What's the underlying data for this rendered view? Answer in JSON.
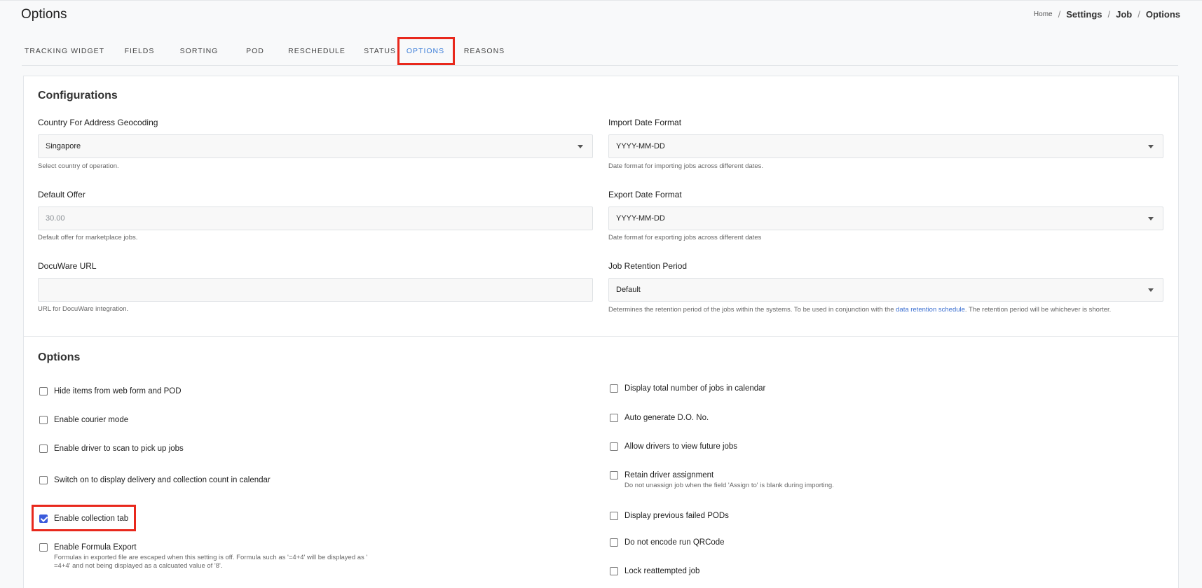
{
  "header": {
    "title": "Options",
    "breadcrumb": {
      "home": "Home",
      "settings": "Settings",
      "job": "Job",
      "current": "Options",
      "separator": "/"
    }
  },
  "tabs": [
    {
      "label": "TRACKING WIDGET",
      "active": false
    },
    {
      "label": "FIELDS",
      "active": false
    },
    {
      "label": "SORTING",
      "active": false
    },
    {
      "label": "POD",
      "active": false
    },
    {
      "label": "RESCHEDULE",
      "active": false
    },
    {
      "label": "STATUS",
      "active": false
    },
    {
      "label": "OPTIONS",
      "active": true
    },
    {
      "label": "REASONS",
      "active": false
    }
  ],
  "configurations": {
    "title": "Configurations",
    "country": {
      "label": "Country For Address Geocoding",
      "value": "Singapore",
      "help": "Select country of operation."
    },
    "import_date": {
      "label": "Import Date Format",
      "value": "YYYY-MM-DD",
      "help": "Date format for importing jobs across different dates."
    },
    "default_offer": {
      "label": "Default Offer",
      "placeholder": "30.00",
      "help": "Default offer for marketplace jobs."
    },
    "export_date": {
      "label": "Export Date Format",
      "value": "YYYY-MM-DD",
      "help": "Date format for exporting jobs across different dates"
    },
    "docuware": {
      "label": "DocuWare URL",
      "value": "",
      "help": "URL for DocuWare integration."
    },
    "retention": {
      "label": "Job Retention Period",
      "value": "Default",
      "help_before": "Determines the retention period of the jobs within the systems. To be used in conjunction with the ",
      "help_link": "data retention schedule",
      "help_after": ". The retention period will be whichever is shorter."
    }
  },
  "options": {
    "title": "Options",
    "left": [
      {
        "label": "Hide items from web form and POD",
        "checked": false
      },
      {
        "label": "Enable courier mode",
        "checked": false
      },
      {
        "label": "Enable driver to scan to pick up jobs",
        "checked": false
      },
      {
        "label": "Switch on to display delivery and collection count in calendar",
        "checked": false
      },
      {
        "label": "Enable collection tab",
        "checked": true
      },
      {
        "label": "Enable Formula Export",
        "checked": false,
        "desc": "Formulas in exported file are escaped when this setting is off. Formula such as '=4+4' will be displayed as ' =4+4' and not being displayed as a calcuated value of '8'."
      }
    ],
    "right": [
      {
        "label": "Display total number of jobs in calendar",
        "checked": false
      },
      {
        "label": "Auto generate D.O. No.",
        "checked": false
      },
      {
        "label": "Allow drivers to view future jobs",
        "checked": false
      },
      {
        "label": "Retain driver assignment",
        "checked": false,
        "desc": "Do not unassign job when the field 'Assign to' is blank during importing."
      },
      {
        "label": "Display previous failed PODs",
        "checked": false
      },
      {
        "label": "Do not encode run QRCode",
        "checked": false
      },
      {
        "label": "Lock reattempted job",
        "checked": false
      }
    ]
  },
  "colors": {
    "accent": "#3b7dd8",
    "checkbox_checked": "#3b5bdb",
    "highlight": "#e8281c"
  }
}
